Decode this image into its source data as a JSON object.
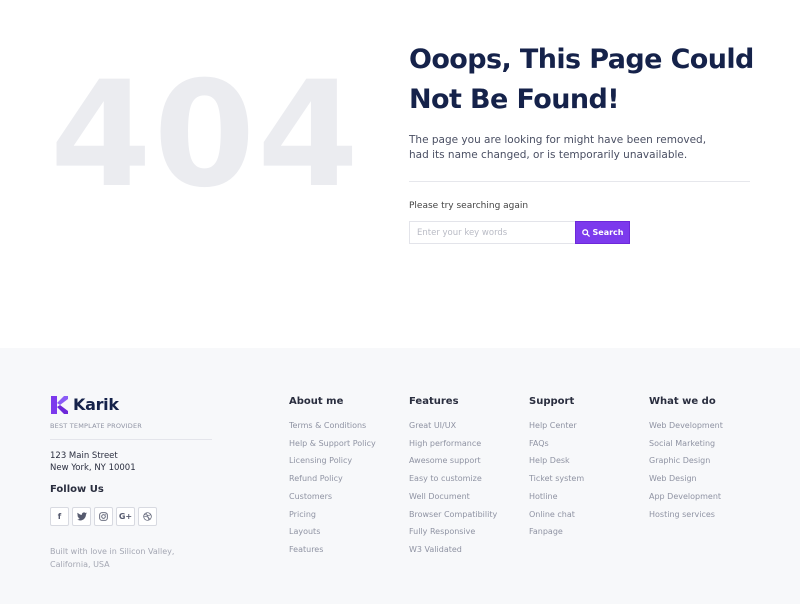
{
  "hero": {
    "code": "404",
    "title_line1": "Ooops, This Page Could",
    "title_line2": "Not Be Found!",
    "desc_line1": "The page you are looking for might have been removed,",
    "desc_line2": "had its name changed, or is temporarily unavailable.",
    "search_label": "Please try searching again",
    "search_placeholder": "Enter your key words",
    "search_value": "",
    "search_button": "Search",
    "search_icon": "search-icon",
    "accent_color": "#7c3aed"
  },
  "footer": {
    "brand": {
      "name": "Karik",
      "tagline": "BEST TEMPLATE PROVIDER",
      "logo_icon": "k-logo-icon",
      "logo_color": "#7c3aed"
    },
    "address_line1": "123 Main Street",
    "address_line2": "New York, NY 10001",
    "follow_title": "Follow Us",
    "socials": [
      {
        "name": "facebook-icon",
        "glyph": "f"
      },
      {
        "name": "twitter-icon",
        "glyph": ""
      },
      {
        "name": "instagram-icon",
        "glyph": ""
      },
      {
        "name": "google-plus-icon",
        "glyph": "G+"
      },
      {
        "name": "dribbble-icon",
        "glyph": ""
      }
    ],
    "built_line1": "Built with love in Silicon Valley,",
    "built_line2": "California, USA",
    "columns": [
      {
        "title": "About me",
        "links": [
          "Terms & Conditions",
          "Help & Support Policy",
          "Licensing Policy",
          "Refund Policy",
          "Customers",
          "Pricing",
          "Layouts",
          "Features"
        ]
      },
      {
        "title": "Features",
        "links": [
          "Great UI/UX",
          "High performance",
          "Awesome support",
          "Easy to customize",
          "Well Document",
          "Browser Compatibility",
          "Fully Responsive",
          "W3 Validated"
        ]
      },
      {
        "title": "Support",
        "links": [
          "Help Center",
          "FAQs",
          "Help Desk",
          "Ticket system",
          "Hotline",
          "Online chat",
          "Fanpage"
        ]
      },
      {
        "title": "What we do",
        "links": [
          "Web Development",
          "Social Marketing",
          "Graphic Design",
          "Web Design",
          "App Development",
          "Hosting services"
        ]
      }
    ]
  }
}
